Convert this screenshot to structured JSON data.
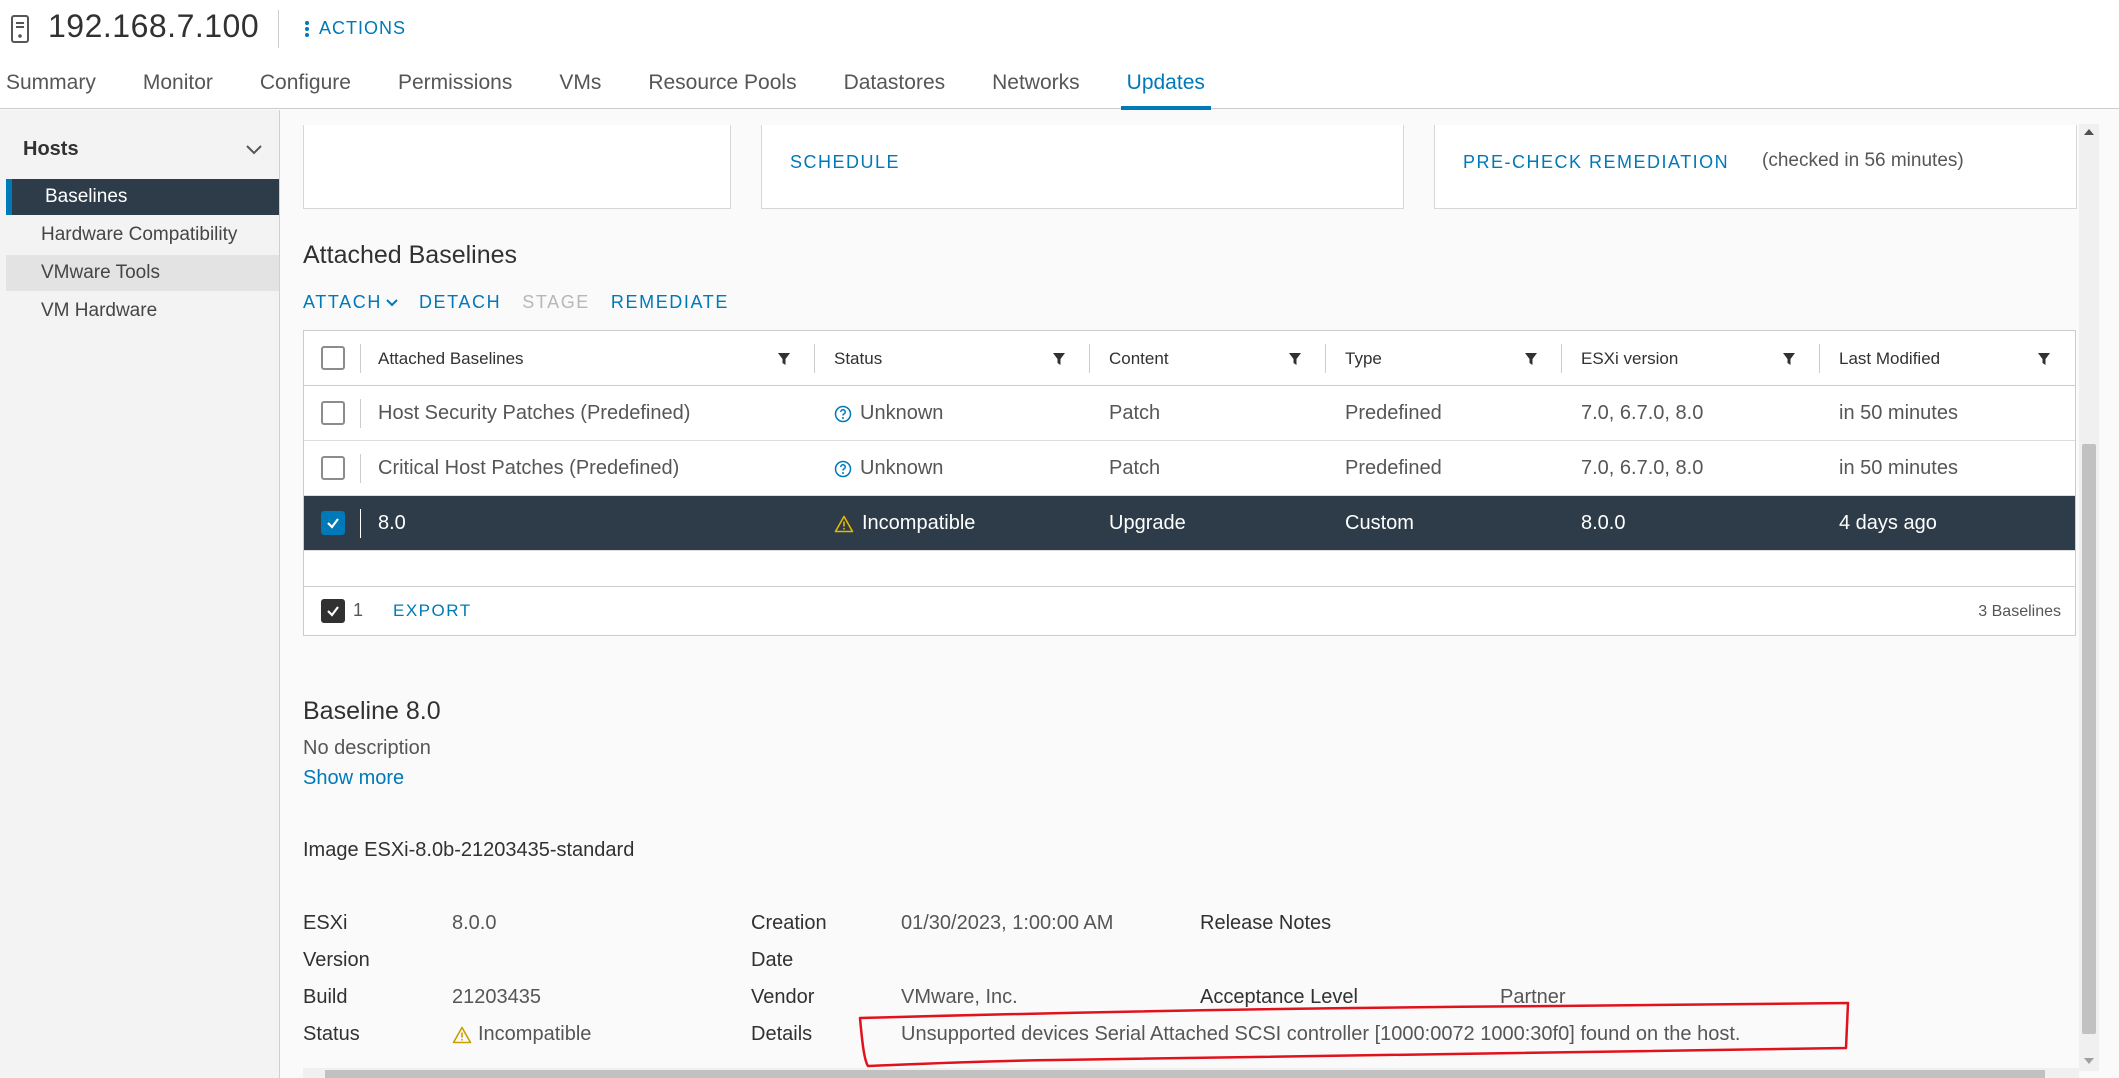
{
  "header": {
    "host_icon": "server-icon",
    "title": "192.168.7.100",
    "actions_label": "ACTIONS"
  },
  "tabs": [
    {
      "label": "Summary"
    },
    {
      "label": "Monitor"
    },
    {
      "label": "Configure"
    },
    {
      "label": "Permissions"
    },
    {
      "label": "VMs"
    },
    {
      "label": "Resource Pools"
    },
    {
      "label": "Datastores"
    },
    {
      "label": "Networks"
    },
    {
      "label": "Updates",
      "active": true
    }
  ],
  "sidebar": {
    "group_label": "Hosts",
    "items": [
      {
        "label": "Baselines",
        "active": true
      },
      {
        "label": "Hardware Compatibility"
      },
      {
        "label": "VMware Tools"
      },
      {
        "label": "VM Hardware"
      }
    ]
  },
  "cards": {
    "schedule_label": "SCHEDULE",
    "precheck_label": "PRE-CHECK REMEDIATION",
    "precheck_note": "(checked in 56 minutes)"
  },
  "attached": {
    "title": "Attached Baselines",
    "toolbar": {
      "attach": "ATTACH",
      "detach": "DETACH",
      "stage": "STAGE",
      "remediate": "REMEDIATE"
    },
    "columns": [
      "Attached Baselines",
      "Status",
      "Content",
      "Type",
      "ESXi version",
      "Last Modified"
    ],
    "rows": [
      {
        "name": "Host Security Patches (Predefined)",
        "status": "Unknown",
        "status_icon": "question-circle-icon",
        "content": "Patch",
        "type": "Predefined",
        "esxi": "7.0, 6.7.0, 8.0",
        "modified": "in 50 minutes",
        "selected": false
      },
      {
        "name": "Critical Host Patches (Predefined)",
        "status": "Unknown",
        "status_icon": "question-circle-icon",
        "content": "Patch",
        "type": "Predefined",
        "esxi": "7.0, 6.7.0, 8.0",
        "modified": "in 50 minutes",
        "selected": false
      },
      {
        "name": "8.0",
        "status": "Incompatible",
        "status_icon": "warning-icon",
        "content": "Upgrade",
        "type": "Custom",
        "esxi": "8.0.0",
        "modified": "4 days ago",
        "selected": true
      }
    ],
    "footer": {
      "selected_count": "1",
      "export": "EXPORT",
      "total": "3 Baselines"
    }
  },
  "baseline": {
    "title": "Baseline 8.0",
    "description": "No description",
    "show_more": "Show more",
    "image_title": "Image ESXi-8.0b-21203435-standard",
    "esxi_label_1": "ESXi",
    "esxi_label_2": "Version",
    "esxi_value": "8.0.0",
    "build_label": "Build",
    "build_value": "21203435",
    "status_label": "Status",
    "status_value": "Incompatible",
    "creation_label_1": "Creation",
    "creation_label_2": "Date",
    "creation_value": "01/30/2023, 1:00:00 AM",
    "vendor_label": "Vendor",
    "vendor_value": "VMware, Inc.",
    "details_label": "Details",
    "details_value": "Unsupported devices Serial Attached SCSI controller [1000:0072 1000:30f0] found on the host.",
    "release_notes_label": "Release Notes",
    "acceptance_label": "Acceptance Level",
    "acceptance_value": "Partner"
  },
  "colors": {
    "accent": "#0079b8",
    "selected_row": "#2d3c48",
    "warning": "#c99f00",
    "annotation": "#e0121b"
  }
}
